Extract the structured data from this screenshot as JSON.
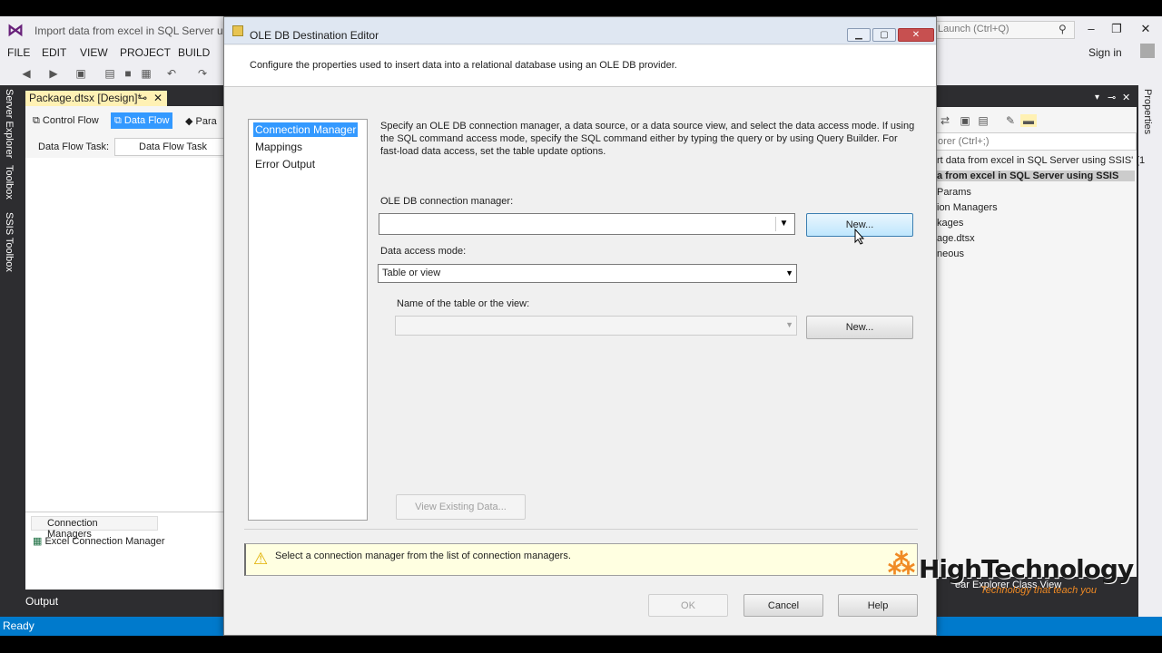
{
  "vs": {
    "title": "Import data from excel in SQL Server using SSIS",
    "quick_launch_placeholder": "Quick Launch (Ctrl+Q)",
    "quick_launch_visible": "Launch (Ctrl+Q)",
    "sign_in": "Sign in",
    "menu": [
      "FILE",
      "EDIT",
      "VIEW",
      "PROJECT",
      "BUILD"
    ],
    "left_rail": [
      "Server Explorer",
      "Toolbox",
      "SSIS Toolbox"
    ],
    "right_rail": "Properties",
    "doc_tab": "Package.dtsx [Design]*",
    "designer_tabs": [
      "Control Flow",
      "Data Flow",
      "Para"
    ],
    "df_task_label": "Data Flow Task:",
    "df_task_value": "Data Flow Task",
    "cm_tab": "Connection Managers",
    "cm_item": "Excel Connection Manager",
    "output": "Output",
    "status": "Ready",
    "solution": {
      "search": "orer (Ctrl+;)",
      "rows": [
        "rt data from excel in SQL Server using SSIS' (1",
        "a from excel in SQL Server using SSIS",
        "Params",
        "ion Managers",
        "kages",
        "age.dtsx",
        "neous"
      ],
      "bottom_tabs": "ear Explorer   Class View"
    },
    "accent": "#007acc"
  },
  "dialog": {
    "title": "OLE DB Destination Editor",
    "description": "Configure the properties used to insert data into a relational database using an OLE DB provider.",
    "nav": [
      "Connection Manager",
      "Mappings",
      "Error Output"
    ],
    "selected_nav": "Connection Manager",
    "content_desc": "Specify an OLE DB connection manager, a data source, or a data source view, and select the data access mode. If using the SQL command access mode, specify the SQL command either by typing the query or by using Query Builder. For fast-load data access, set the table update options.",
    "cm_label": "OLE DB connection manager:",
    "cm_value": "",
    "new_label": "New...",
    "dam_label": "Data access mode:",
    "dam_value": "Table or view",
    "table_label": "Name of the table or the view:",
    "table_value": "",
    "view_existing": "View Existing Data...",
    "message": "Select a connection manager from the list of connection managers.",
    "ok": "OK",
    "cancel": "Cancel",
    "help": "Help"
  },
  "watermark": {
    "title": "HighTechnology",
    "subtitle": "Technology that teach you"
  }
}
